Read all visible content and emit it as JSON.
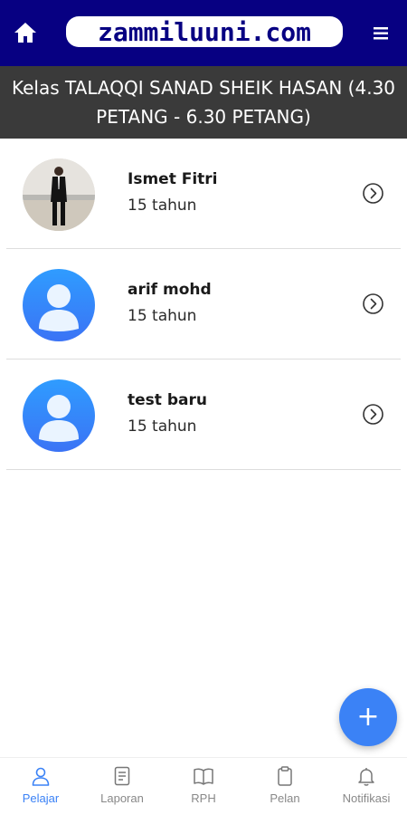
{
  "header": {
    "logo_text": "zammiluuni.com",
    "home_icon": "home-icon",
    "menu_icon": "hamburger-menu-icon",
    "bg_color": "#070082"
  },
  "class_title": "Kelas TALAQQI SANAD SHEIK HASAN (4.30 PETANG - 6.30 PETANG)",
  "students": [
    {
      "name": "Ismet Fitri",
      "age": "15 tahun",
      "avatar": "photo"
    },
    {
      "name": "arif mohd",
      "age": "15 tahun",
      "avatar": "default-user-icon"
    },
    {
      "name": "test baru",
      "age": "15 tahun",
      "avatar": "default-user-icon"
    }
  ],
  "fab": {
    "label": "+",
    "color": "#3b82f6"
  },
  "nav": [
    {
      "label": "Pelajar",
      "icon": "person-icon",
      "active": true
    },
    {
      "label": "Laporan",
      "icon": "document-icon",
      "active": false
    },
    {
      "label": "RPH",
      "icon": "book-icon",
      "active": false
    },
    {
      "label": "Pelan",
      "icon": "clipboard-icon",
      "active": false
    },
    {
      "label": "Notifikasi",
      "icon": "bell-icon",
      "active": false
    }
  ],
  "accent_color": "#3b82f6"
}
